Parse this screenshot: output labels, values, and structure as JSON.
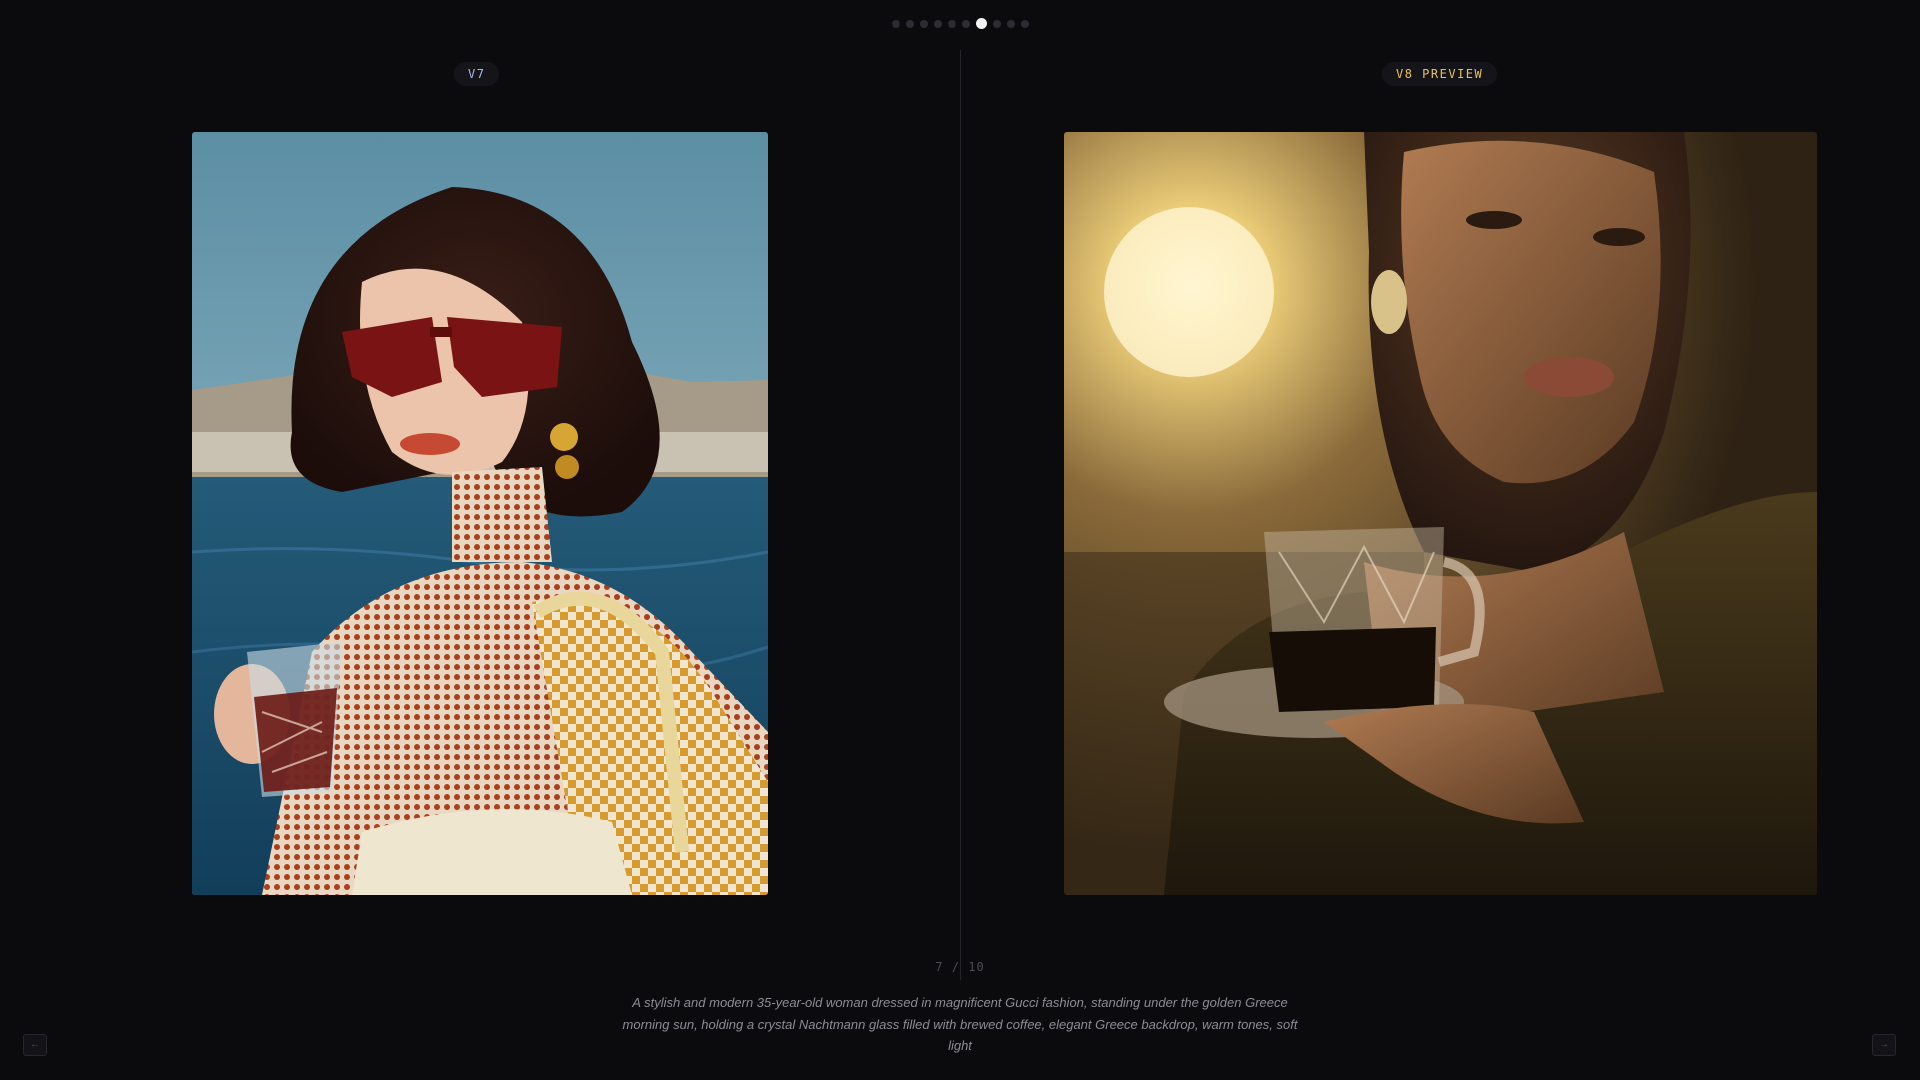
{
  "pagination": {
    "total": 10,
    "active_index": 6
  },
  "panels": {
    "left": {
      "badge": "V7",
      "image_alt": "Woman in red sunglasses and a patterned outfit holding a crystal glass by the sea"
    },
    "right": {
      "badge": "V8 PREVIEW",
      "image_alt": "Woman at golden sunset holding a crystal cup of coffee on a saucer"
    }
  },
  "counter": {
    "current": "7",
    "separator": "/",
    "total": "10"
  },
  "caption": "A stylish and modern 35-year-old woman dressed in magnificent Gucci fashion, standing under the golden Greece morning sun, holding a crystal Nachtmann glass filled with brewed coffee, elegant Greece backdrop, warm tones, soft light",
  "nav": {
    "prev_icon": "arrow-left-icon",
    "next_icon": "arrow-right-icon"
  },
  "colors": {
    "background": "#0b0b0e",
    "v7_badge_text": "#a8b8f0",
    "v8_badge_text": "#e8c25a",
    "dot_active": "#f2f2f4",
    "dot_inactive": "#2c2c33"
  }
}
